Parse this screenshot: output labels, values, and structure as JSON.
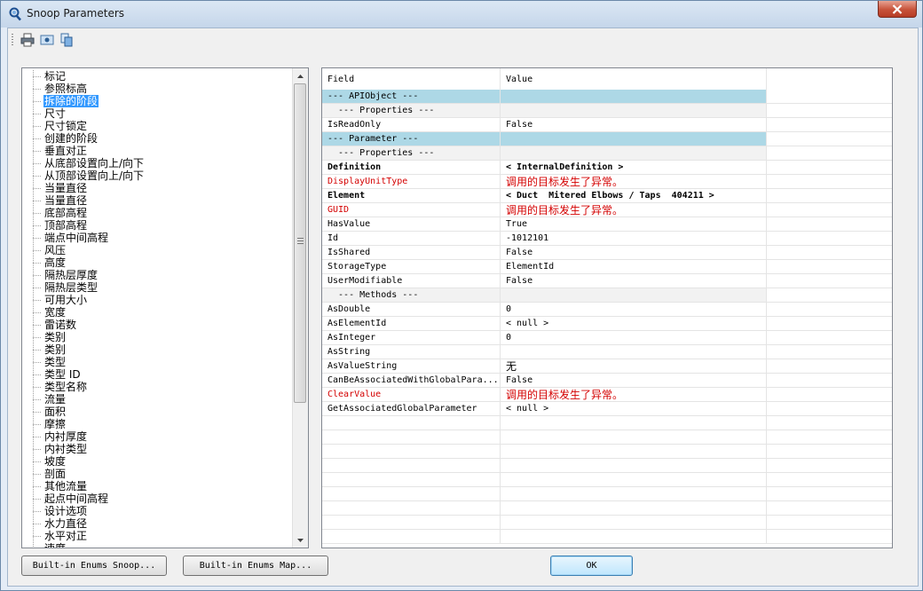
{
  "window": {
    "title": "Snoop Parameters"
  },
  "toolbar": {
    "icons": [
      "print-icon",
      "print-preview-icon",
      "copy-icon"
    ]
  },
  "tree": {
    "selected_index": 2,
    "items": [
      "标记",
      "参照标高",
      "拆除的阶段",
      "尺寸",
      "尺寸锁定",
      "创建的阶段",
      "垂直对正",
      "从底部设置向上/向下",
      "从顶部设置向上/向下",
      "当量直径",
      "当量直径",
      "底部高程",
      "顶部高程",
      "端点中间高程",
      "风压",
      "高度",
      "隔热层厚度",
      "隔热层类型",
      "可用大小",
      "宽度",
      "雷诺数",
      "类别",
      "类别",
      "类型",
      "类型 ID",
      "类型名称",
      "流量",
      "面积",
      "摩擦",
      "内衬厚度",
      "内衬类型",
      "坡度",
      "剖面",
      "其他流量",
      "起点中间高程",
      "设计选项",
      "水力直径",
      "水平对正",
      "速度"
    ]
  },
  "grid": {
    "columns": [
      "Field",
      "Value"
    ],
    "rows": [
      {
        "field": "--- APIObject ---",
        "value": "",
        "style": "hdr-blue"
      },
      {
        "field": "  --- Properties ---",
        "value": "",
        "style": "hdr-gray"
      },
      {
        "field": "IsReadOnly",
        "value": "False",
        "style": ""
      },
      {
        "field": "--- Parameter ---",
        "value": "",
        "style": "hdr-blue"
      },
      {
        "field": "  --- Properties ---",
        "value": "",
        "style": "hdr-gray"
      },
      {
        "field": "Definition",
        "value": "< InternalDefinition >",
        "style": "bold"
      },
      {
        "field": "DisplayUnitType",
        "value": "调用的目标发生了异常。",
        "style": "red"
      },
      {
        "field": "Element",
        "value": "< Duct  Mitered Elbows / Taps  404211 >",
        "style": "bold"
      },
      {
        "field": "GUID",
        "value": "调用的目标发生了异常。",
        "style": "red"
      },
      {
        "field": "HasValue",
        "value": "True",
        "style": ""
      },
      {
        "field": "Id",
        "value": "-1012101",
        "style": ""
      },
      {
        "field": "IsShared",
        "value": "False",
        "style": ""
      },
      {
        "field": "StorageType",
        "value": "ElementId",
        "style": ""
      },
      {
        "field": "UserModifiable",
        "value": "False",
        "style": ""
      },
      {
        "field": "  --- Methods ---",
        "value": "",
        "style": "hdr-gray"
      },
      {
        "field": "AsDouble",
        "value": "0",
        "style": ""
      },
      {
        "field": "AsElementId",
        "value": "< null >",
        "style": ""
      },
      {
        "field": "AsInteger",
        "value": "0",
        "style": ""
      },
      {
        "field": "AsString",
        "value": "",
        "style": ""
      },
      {
        "field": "AsValueString",
        "value": "无",
        "style": ""
      },
      {
        "field": "CanBeAssociatedWithGlobalPara...",
        "value": "False",
        "style": ""
      },
      {
        "field": "ClearValue",
        "value": "调用的目标发生了异常。",
        "style": "red"
      },
      {
        "field": "GetAssociatedGlobalParameter",
        "value": "< null >",
        "style": ""
      }
    ],
    "empty_rows": 9
  },
  "buttons": {
    "enums_snoop": "Built-in Enums Snoop...",
    "enums_map": "Built-in Enums Map...",
    "ok": "OK"
  }
}
